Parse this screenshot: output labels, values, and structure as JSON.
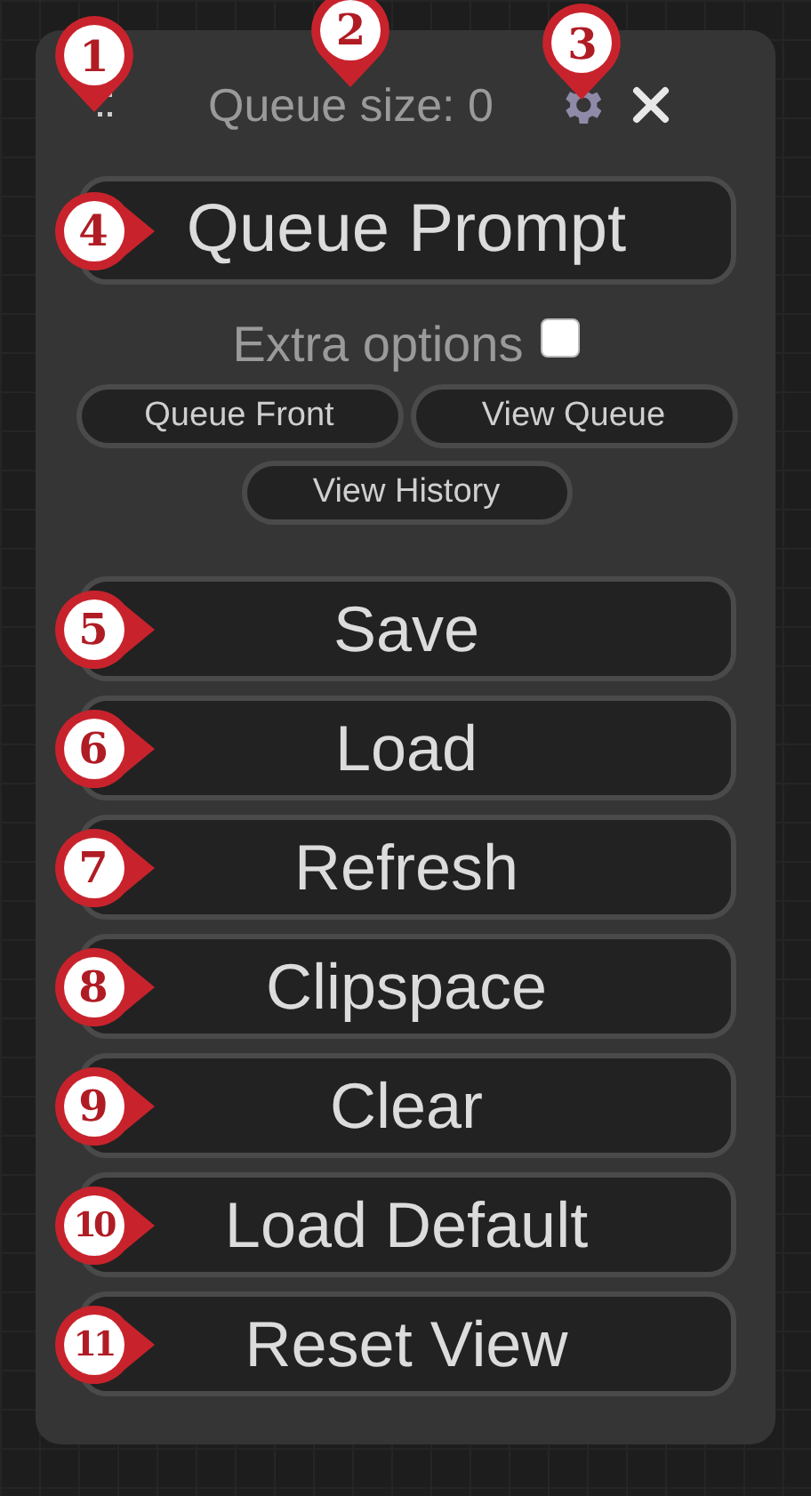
{
  "header": {
    "handle_marker": "1",
    "title": "Queue size: 0",
    "title_marker": "2",
    "settings_marker": "3"
  },
  "queue_button": {
    "label": "Queue Prompt",
    "marker": "4"
  },
  "extra_options": {
    "label": "Extra options",
    "checked": false
  },
  "small_buttons": [
    {
      "label": "Queue Front"
    },
    {
      "label": "View Queue"
    },
    {
      "label": "View History"
    }
  ],
  "buttons": [
    {
      "label": "Save",
      "marker": "5"
    },
    {
      "label": "Load",
      "marker": "6"
    },
    {
      "label": "Refresh",
      "marker": "7"
    },
    {
      "label": "Clipspace",
      "marker": "8"
    },
    {
      "label": "Clear",
      "marker": "9"
    },
    {
      "label": "Load Default",
      "marker": "10"
    },
    {
      "label": "Reset View",
      "marker": "11"
    }
  ]
}
